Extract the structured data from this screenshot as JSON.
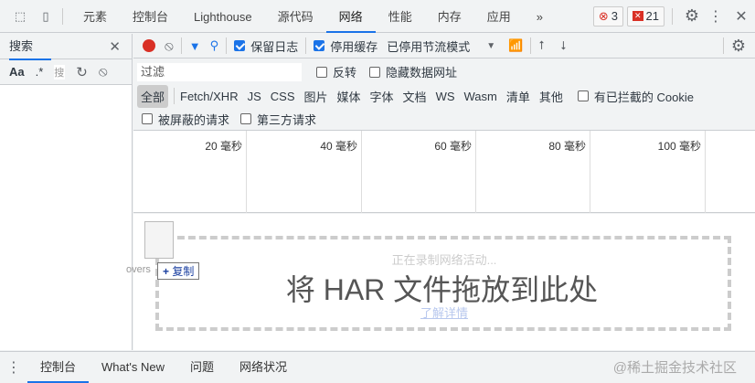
{
  "tabs": [
    "元素",
    "控制台",
    "Lighthouse",
    "源代码",
    "网络",
    "性能",
    "内存",
    "应用"
  ],
  "active_tab": "网络",
  "more": "»",
  "errors": "3",
  "issues": "21",
  "search": {
    "title": "搜索",
    "placeholder": "搜",
    "aa": "Aa",
    "regex": ".*"
  },
  "toolbar": {
    "preserve_log": "保留日志",
    "disable_cache": "停用缓存",
    "throttle": "已停用节流模式"
  },
  "filter": {
    "placeholder": "过滤",
    "invert": "反转",
    "hide_data_urls": "隐藏数据网址"
  },
  "types": [
    "全部",
    "Fetch/XHR",
    "JS",
    "CSS",
    "图片",
    "媒体",
    "字体",
    "文档",
    "WS",
    "Wasm",
    "清单",
    "其他"
  ],
  "blocked_cookies": "有已拦截的 Cookie",
  "blocked_requests": "被屏蔽的请求",
  "third_party": "第三方请求",
  "ticks": [
    "20 毫秒",
    "40 毫秒",
    "60 毫秒",
    "80 毫秒",
    "100 毫秒"
  ],
  "drop": {
    "recording": "正在录制网络活动...",
    "har": "将 HAR 文件拖放到此处",
    "learn_more": "了解详情",
    "drag_label": "overs",
    "copy": "复制"
  },
  "drawer": [
    "控制台",
    "What's New",
    "问题",
    "网络状况"
  ],
  "watermark": "@稀土掘金技术社区"
}
